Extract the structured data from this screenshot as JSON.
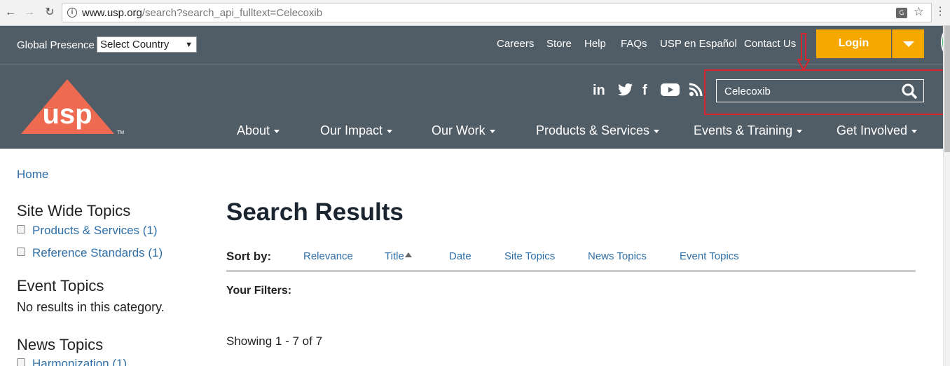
{
  "browser": {
    "url_host": "www.usp.org",
    "url_path": "/search?search_api_fulltext=Celecoxib",
    "translate_badge": "G"
  },
  "topbar": {
    "global_label": "Global Presence",
    "country_select": "Select Country",
    "links": [
      "Careers",
      "Store",
      "Help",
      "FAQs",
      "USP en Español",
      "Contact Us"
    ],
    "login_label": "Login",
    "accent_color": "#f7a800",
    "header_color": "#515d66"
  },
  "header": {
    "logo_text": "usp",
    "logo_tm": "TM",
    "logo_color": "#ee6a50",
    "social_icons": [
      "linkedin-icon",
      "twitter-icon",
      "facebook-icon",
      "youtube-icon",
      "rss-icon"
    ],
    "search_value": "Celecoxib",
    "highlight_color": "#d9232d",
    "nav": [
      "About",
      "Our Impact",
      "Our Work",
      "Products & Services",
      "Events & Training",
      "Get Involved"
    ]
  },
  "breadcrumb": {
    "home": "Home"
  },
  "sidebar": {
    "site_wide_title": "Site Wide Topics",
    "site_wide_items": [
      "Products & Services (1)",
      "Reference Standards (1)"
    ],
    "event_title": "Event Topics",
    "event_empty": "No results in this category.",
    "news_title": "News Topics",
    "news_items": [
      "Harmonization (1)"
    ]
  },
  "main": {
    "title": "Search Results",
    "sort_label": "Sort by:",
    "sort_options": [
      "Relevance",
      "Title",
      "Date",
      "Site Topics",
      "News Topics",
      "Event Topics"
    ],
    "filters_label": "Your Filters:",
    "showing": "Showing 1 - 7 of 7"
  }
}
